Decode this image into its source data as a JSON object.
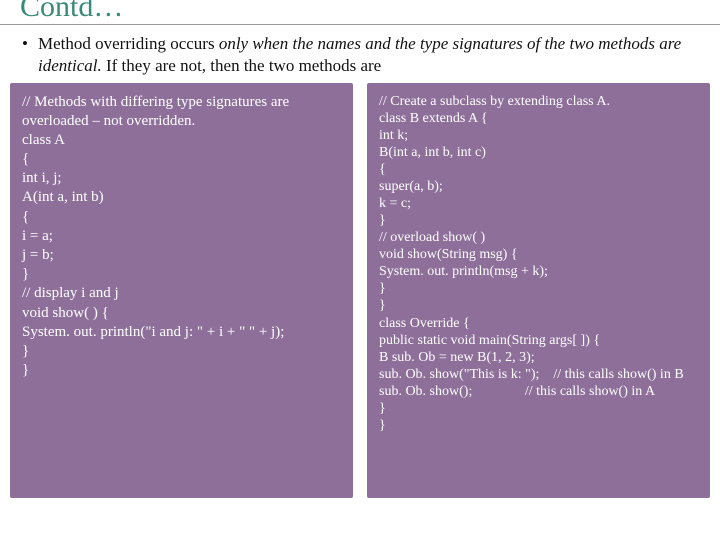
{
  "title": "Contd…",
  "bullet": {
    "dot": "•",
    "pre": "Method overriding occurs ",
    "ital": "only when the names and the type signatures of the two methods are identical.",
    "post": " If they are not, then the two methods are"
  },
  "code_left": "// Methods with differing type signatures are overloaded – not overridden.\nclass A\n{\nint i, j;\nA(int a, int b)\n{\ni = a;\nj = b;\n}\n// display i and j\nvoid show( ) {\nSystem. out. println(\"i and j: \" + i + \" \" + j);\n}\n}",
  "code_right": "// Create a subclass by extending class A.\nclass B extends A {\nint k;\nB(int a, int b, int c)\n{\nsuper(a, b);\nk = c;\n}\n// overload show( )\nvoid show(String msg) {\nSystem. out. println(msg + k);\n}\n}\nclass Override {\npublic static void main(String args[ ]) {\nB sub. Ob = new B(1, 2, 3);\nsub. Ob. show(\"This is k: \");    // this calls show() in B\nsub. Ob. show();               // this calls show() in A\n}\n}"
}
